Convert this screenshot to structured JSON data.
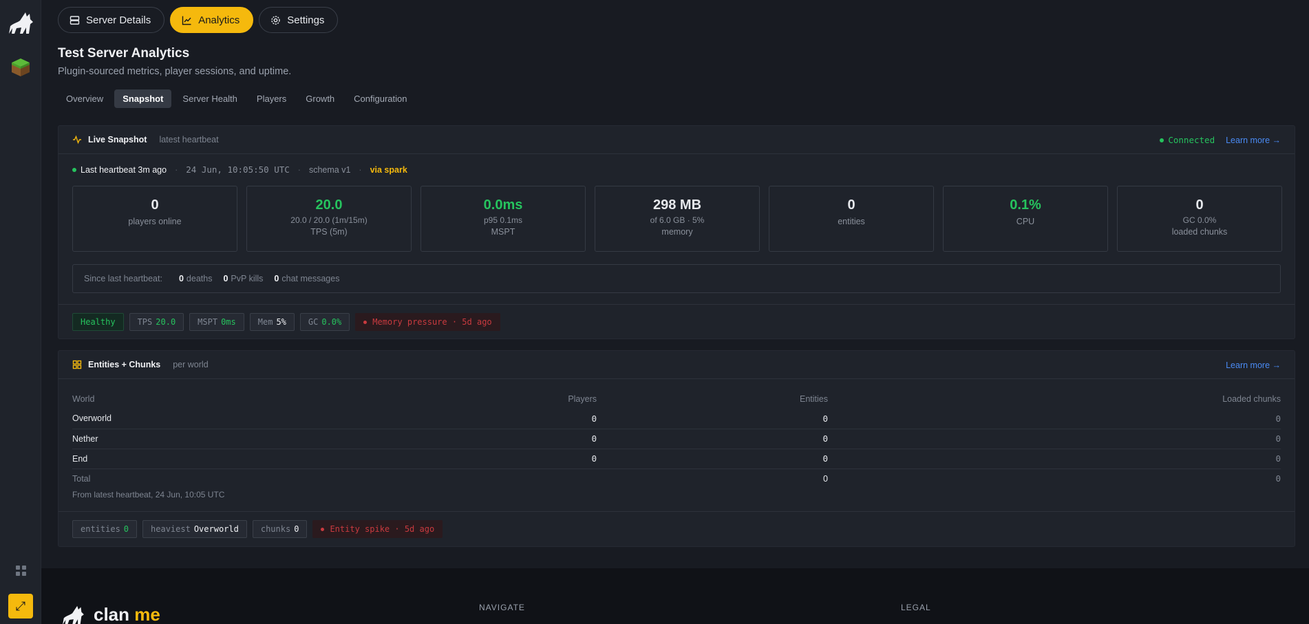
{
  "colors": {
    "accent": "#f5b90d",
    "green": "#26c35e",
    "link": "#4a8bf5",
    "alert": "#c93a3f"
  },
  "top_tabs": [
    {
      "label": "Server Details",
      "icon": "server-icon"
    },
    {
      "label": "Analytics",
      "icon": "chart-line-icon"
    },
    {
      "label": "Settings",
      "icon": "gear-icon"
    }
  ],
  "page": {
    "title": "Test Server Analytics",
    "subtitle": "Plugin-sourced metrics, player sessions, and uptime."
  },
  "subtabs": [
    "Overview",
    "Snapshot",
    "Server Health",
    "Players",
    "Growth",
    "Configuration"
  ],
  "snapshot": {
    "title": "Live Snapshot",
    "subtitle": "latest heartbeat",
    "status": "Connected",
    "learn_more": "Learn more →",
    "heartbeat": "Last heartbeat 3m ago",
    "timestamp": "24 Jun, 10:05:50 UTC",
    "schema": "schema v1",
    "source": "via spark",
    "stats": [
      {
        "value": "0",
        "detail": "",
        "label": "players online"
      },
      {
        "value": "20.0",
        "detail": "20.0 / 20.0 (1m/15m)",
        "label": "TPS (5m)"
      },
      {
        "value": "0.0ms",
        "detail": "p95 0.1ms",
        "label": "MSPT"
      },
      {
        "value": "298 MB",
        "detail": "of 6.0 GB · 5%",
        "label": "memory"
      },
      {
        "value": "0",
        "detail": "",
        "label": "entities"
      },
      {
        "value": "0.1%",
        "detail": "",
        "label": "CPU"
      },
      {
        "value": "0",
        "detail": "GC 0.0%",
        "label": "loaded chunks"
      }
    ],
    "since_label": "Since last heartbeat:",
    "since": [
      {
        "count": "0",
        "label": "deaths"
      },
      {
        "count": "0",
        "label": "PvP kills"
      },
      {
        "count": "0",
        "label": "chat messages"
      }
    ],
    "pills": {
      "healthy": "Healthy",
      "tps_k": "TPS",
      "tps_v": "20.0",
      "mspt_k": "MSPT",
      "mspt_v": "0ms",
      "mem_k": "Mem",
      "mem_v": "5%",
      "gc_k": "GC",
      "gc_v": "0.0%",
      "alert": "Memory pressure · 5d ago"
    }
  },
  "entities": {
    "title": "Entities + Chunks",
    "subtitle": "per world",
    "learn_more": "Learn more →",
    "columns": [
      "World",
      "Players",
      "Entities",
      "Loaded chunks"
    ],
    "rows": [
      {
        "world": "Overworld",
        "players": "0",
        "entities": "0",
        "chunks": "0"
      },
      {
        "world": "Nether",
        "players": "0",
        "entities": "0",
        "chunks": "0"
      },
      {
        "world": "End",
        "players": "0",
        "entities": "0",
        "chunks": "0"
      }
    ],
    "total": {
      "label": "Total",
      "entities": "0",
      "chunks": "0"
    },
    "from": "From latest heartbeat, 24 Jun, 10:05 UTC",
    "pills": {
      "entities_k": "entities",
      "entities_v": "0",
      "heaviest_k": "heaviest",
      "heaviest_v": "Overworld",
      "chunks_k": "chunks",
      "chunks_v": "0",
      "alert": "Entity spike · 5d ago"
    }
  },
  "footer": {
    "brand_a": "clan",
    "brand_b": "me",
    "navigate": "NAVIGATE",
    "legal": "LEGAL"
  }
}
